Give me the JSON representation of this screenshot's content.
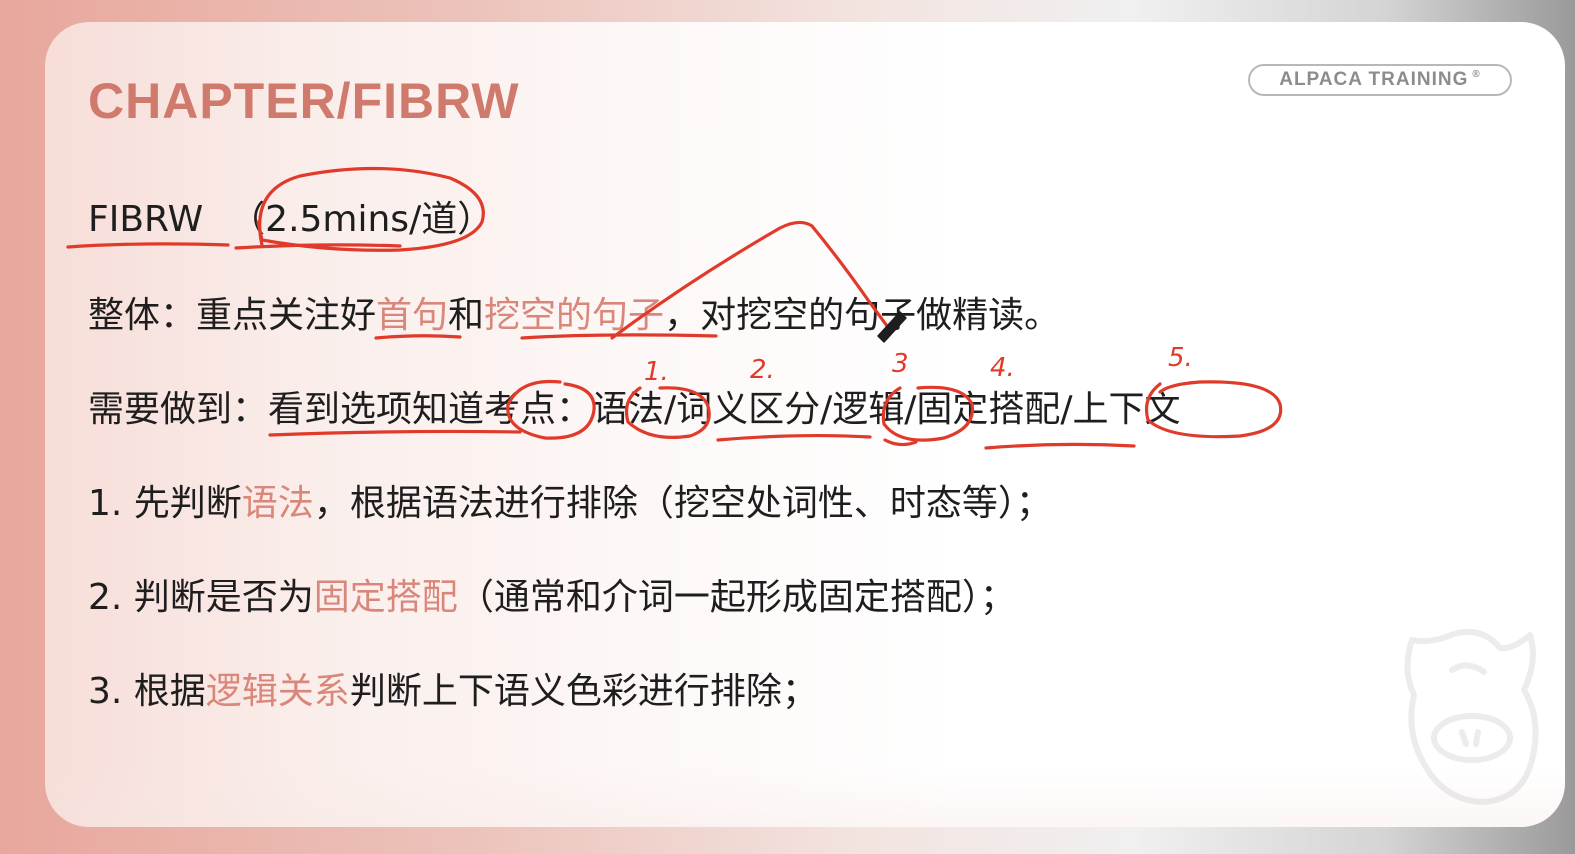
{
  "slide": {
    "chapter_title": "CHAPTER/FIBRW",
    "brand": "ALPACA TRAINING",
    "brand_tm": "®",
    "line1": {
      "label": "FIBRW",
      "time": "（2.5mins/道）"
    },
    "line2": {
      "prefix": "整体：重点关注好",
      "accent1": "首句",
      "mid": "和",
      "accent2": "挖空的句子",
      "suffix": "，对挖空的句子做精读。"
    },
    "line3": {
      "prefix": "需要做到：看到选项知道考点：",
      "points": "语法/词义区分/逻辑/固定搭配/上下文"
    },
    "line4": {
      "prefix": "1. 先判断",
      "accent": "语法",
      "suffix": "，根据语法进行排除（挖空处词性、时态等）；"
    },
    "line5": {
      "prefix": "2. 判断是否为",
      "accent": "固定搭配",
      "suffix": "（通常和介词一起形成固定搭配）；"
    },
    "line6": {
      "prefix": "3. 根据",
      "accent": "逻辑关系",
      "suffix": "判断上下语义色彩进行排除；"
    }
  },
  "handwriting": {
    "numbers": [
      "1.",
      "2.",
      "3",
      "4.",
      "5."
    ]
  },
  "colors": {
    "title": "#cf7a6c",
    "accent_text": "#d9877a",
    "ink": "#e03a2a",
    "body_text": "#1e1e1e"
  },
  "icons": {
    "mascot": "alpaca-mascot-icon",
    "pen_cursor": "pen-cursor-icon"
  }
}
